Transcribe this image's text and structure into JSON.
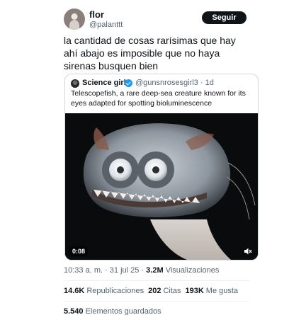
{
  "author": {
    "name": "flor",
    "handle": "@palanttt",
    "follow_label": "Seguir"
  },
  "tweet": {
    "text": "la cantidad de cosas rarísimas que hay ahí abajo es imposible que no haya sirenas busquen bien"
  },
  "quoted": {
    "name": "Science girl",
    "meta": "@gunsnrosesgirl3 · 1d",
    "text": "Telescopefish, a rare deep-sea creature known for its eyes adapted for spotting bioluminescence",
    "video_duration": "0:08",
    "icons": [
      "verified-icon",
      "mute-icon"
    ]
  },
  "details": {
    "time": "10:33 a. m. · 31 jul 25 · ",
    "views_count": "3.2M",
    "views_label": "Visualizaciones"
  },
  "stats": {
    "reposts_count": "14.6K",
    "reposts_label": "Republicaciones",
    "quotes_count": "202",
    "quotes_label": "Citas",
    "likes_count": "193K",
    "likes_label": "Me gusta",
    "saves_count": "5.540",
    "saves_label": "Elementos guardados"
  },
  "colors": {
    "text": "#0f1419",
    "secondary": "#536471",
    "border": "#cfd9de",
    "verified": "#1d9bf0",
    "button": "#0f1419"
  }
}
